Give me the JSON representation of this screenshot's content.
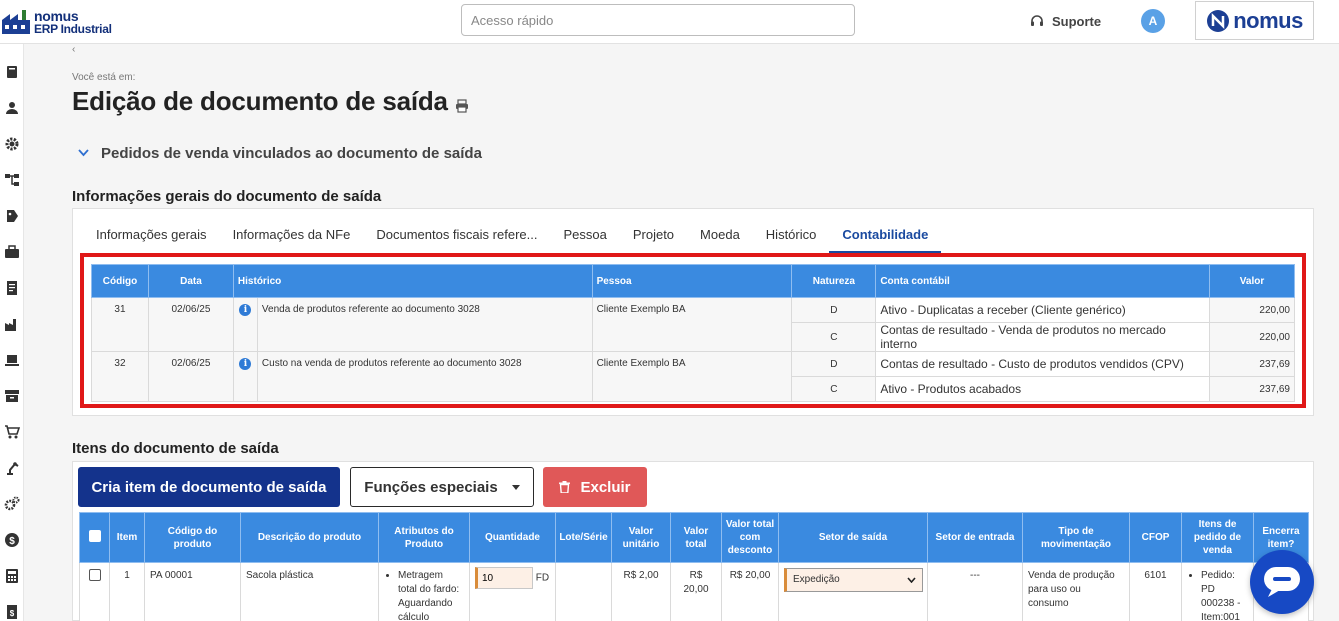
{
  "header": {
    "logo_line1": "nomus",
    "logo_line2": "ERP Industrial",
    "quick_access_placeholder": "Acesso rápido",
    "support_label": "Suporte",
    "avatar_initial": "A",
    "brand_word": "nomus"
  },
  "sidebar": {
    "icons": [
      "book-icon",
      "user-icon",
      "gear-icon",
      "hierarchy-icon",
      "tag-icon",
      "briefcase-icon",
      "document-icon",
      "factory-icon",
      "pallet-icon",
      "archive-icon",
      "cart-icon",
      "robot-arm-icon",
      "gears-icon",
      "dollar-icon",
      "calculator-icon",
      "report-icon"
    ]
  },
  "page": {
    "breadcrumb_label": "Você está em:",
    "breadcrumb_mark": "‹",
    "title": "Edição de documento de saída",
    "linked_orders_title": "Pedidos de venda vinculados ao documento de saída",
    "general_info_title": "Informações gerais do documento de saída",
    "items_title": "Itens do documento de saída"
  },
  "tabs": [
    {
      "label": "Informações gerais",
      "active": false
    },
    {
      "label": "Informações da NFe",
      "active": false
    },
    {
      "label": "Documentos fiscais refere...",
      "active": false
    },
    {
      "label": "Pessoa",
      "active": false
    },
    {
      "label": "Projeto",
      "active": false
    },
    {
      "label": "Moeda",
      "active": false
    },
    {
      "label": "Histórico",
      "active": false
    },
    {
      "label": "Contabilidade",
      "active": true
    }
  ],
  "accounting_table": {
    "headers": {
      "codigo": "Código",
      "data": "Data",
      "historico": "Histórico",
      "pessoa": "Pessoa",
      "natureza": "Natureza",
      "conta": "Conta contábil",
      "valor": "Valor"
    },
    "entries": [
      {
        "codigo": "31",
        "data": "02/06/25",
        "historico": "Venda de produtos referente ao documento 3028",
        "pessoa": "Cliente Exemplo BA",
        "lines": [
          {
            "natureza": "D",
            "conta": "Ativo - Duplicatas a receber (Cliente genérico)",
            "valor": "220,00"
          },
          {
            "natureza": "C",
            "conta": "Contas de resultado - Venda de produtos no mercado interno",
            "valor": "220,00"
          }
        ]
      },
      {
        "codigo": "32",
        "data": "02/06/25",
        "historico": "Custo na venda de produtos referente ao documento 3028",
        "pessoa": "Cliente Exemplo BA",
        "lines": [
          {
            "natureza": "D",
            "conta": "Contas de resultado - Custo de produtos vendidos (CPV)",
            "valor": "237,69"
          },
          {
            "natureza": "C",
            "conta": "Ativo - Produtos acabados",
            "valor": "237,69"
          }
        ]
      }
    ]
  },
  "buttons": {
    "create_item": "Cria item de documento de saída",
    "special_functions": "Funções especiais",
    "delete": "Excluir"
  },
  "items_table": {
    "headers": {
      "item": "Item",
      "codigo": "Código do produto",
      "descricao": "Descrição do produto",
      "atributos": "Atributos do Produto",
      "quantidade": "Quantidade",
      "lote": "Lote/Série",
      "valor_unitario": "Valor unitário",
      "valor_total": "Valor total",
      "valor_desconto": "Valor total com desconto",
      "setor_saida": "Setor de saída",
      "setor_entrada": "Setor de entrada",
      "tipo_mov": "Tipo de movimentação",
      "cfop": "CFOP",
      "itens_pedido": "Itens de pedido de venda",
      "encerra": "Encerra item?"
    },
    "rows": [
      {
        "item": "1",
        "codigo": "PA 00001",
        "descricao": "Sacola plástica",
        "atributos": "Metragem total do fardo: Aguardando cálculo",
        "quantidade": "10",
        "unidade": "FD",
        "lote": "",
        "valor_unitario": "R$ 2,00",
        "valor_total": "R$ 20,00",
        "valor_desconto": "R$ 20,00",
        "setor_saida": "Expedição",
        "setor_entrada": "---",
        "tipo_mov": "Venda de produção para uso ou consumo",
        "cfop": "6101",
        "itens_pedido": "Pedido: PD 000238 - Item:001"
      }
    ]
  },
  "colors": {
    "table_header": "#3a8ae0",
    "primary_button": "#14338c",
    "danger_button": "#e05858",
    "highlight_border": "#e01818",
    "active_tab": "#1a4aa0"
  }
}
